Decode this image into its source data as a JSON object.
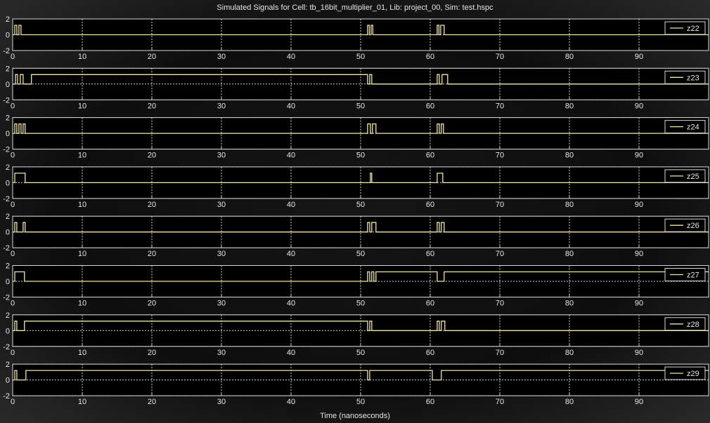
{
  "chart_data": {
    "type": "line",
    "title": "Simulated Signals for Cell: tb_16bit_multiplier_01, Lib: project_00, Sim: test.hspc",
    "xlabel": "Time (nanoseconds)",
    "xlim": [
      0,
      100
    ],
    "ylim": [
      -2,
      2
    ],
    "xticks": [
      0,
      10,
      20,
      30,
      40,
      50,
      60,
      70,
      80,
      90
    ],
    "yticks": [
      -2,
      0,
      2
    ],
    "grid": true,
    "legend_position": "top-right",
    "colors": {
      "background": "#000000",
      "trace": "#f0e6a0",
      "grid": "#d8d8d8",
      "text": "#e6e6e6"
    },
    "series": [
      {
        "name": "z22",
        "t": [
          0,
          0.3,
          0.3,
          0.6,
          0.6,
          0.9,
          0.9,
          1.2,
          1.2,
          2.7,
          2.7,
          51.0,
          51.0,
          51.25,
          51.25,
          51.5,
          51.5,
          51.75,
          51.75,
          52.0,
          52.0,
          61.0,
          61.0,
          61.25,
          61.25,
          61.5,
          61.5,
          62.0,
          62.0,
          62.3,
          62.3,
          100
        ],
        "v": [
          0,
          0,
          1.2,
          1.2,
          0,
          0,
          1.2,
          1.2,
          0,
          0,
          0,
          0,
          1.2,
          1.2,
          0,
          0,
          1.2,
          1.2,
          0,
          0,
          0,
          0,
          1.2,
          1.2,
          0,
          0,
          1.2,
          1.2,
          0,
          0,
          0,
          0
        ]
      },
      {
        "name": "z23",
        "t": [
          0,
          0.4,
          0.4,
          0.7,
          0.7,
          1.1,
          1.1,
          1.5,
          1.5,
          2.7,
          2.7,
          51.0,
          51.0,
          51.3,
          51.3,
          51.6,
          51.6,
          51.9,
          51.9,
          61.0,
          61.0,
          61.3,
          61.3,
          61.7,
          61.7,
          62.5,
          62.5,
          100
        ],
        "v": [
          0,
          0,
          1.2,
          1.2,
          0,
          0,
          1.2,
          1.2,
          0,
          0,
          1.2,
          1.2,
          0,
          0,
          1.2,
          1.2,
          0,
          0,
          0,
          0,
          1.2,
          1.2,
          0,
          0,
          1.2,
          1.2,
          0,
          0
        ]
      },
      {
        "name": "z24",
        "t": [
          0,
          0.3,
          0.3,
          0.6,
          0.6,
          0.9,
          0.9,
          1.2,
          1.2,
          1.5,
          1.5,
          1.8,
          1.8,
          51.0,
          51.0,
          51.4,
          51.4,
          51.7,
          51.7,
          52.2,
          52.2,
          61.0,
          61.0,
          61.3,
          61.3,
          61.6,
          61.6,
          61.9,
          61.9,
          62.2,
          62.2,
          100
        ],
        "v": [
          0,
          0,
          1.2,
          1.2,
          0,
          0,
          1.2,
          1.2,
          0,
          0,
          1.2,
          1.2,
          0,
          0,
          1.2,
          1.2,
          0,
          0,
          1.2,
          1.2,
          0,
          0,
          1.2,
          1.2,
          0,
          0,
          1.2,
          1.2,
          0,
          0,
          0,
          0
        ]
      },
      {
        "name": "z25",
        "t": [
          0,
          0.3,
          0.3,
          1.8,
          1.8,
          51.4,
          51.4,
          51.6,
          51.6,
          61.0,
          61.0,
          61.8,
          61.8,
          100
        ],
        "v": [
          0,
          0,
          1.2,
          1.2,
          0,
          0,
          1.2,
          1.2,
          0,
          0,
          1.2,
          1.2,
          0,
          0
        ]
      },
      {
        "name": "z26",
        "t": [
          0,
          0.3,
          0.3,
          0.6,
          0.6,
          1.5,
          1.5,
          1.8,
          1.8,
          51.0,
          51.0,
          51.3,
          51.3,
          51.6,
          51.6,
          52.2,
          52.2,
          61.0,
          61.0,
          61.3,
          61.3,
          61.6,
          61.6,
          62.0,
          62.0,
          100
        ],
        "v": [
          0,
          0,
          1.2,
          1.2,
          0,
          0,
          1.2,
          1.2,
          0,
          0,
          1.2,
          1.2,
          0,
          0,
          1.2,
          1.2,
          0,
          0,
          1.2,
          1.2,
          0,
          0,
          1.2,
          1.2,
          0,
          0
        ]
      },
      {
        "name": "z27",
        "t": [
          0,
          0.3,
          0.3,
          1.7,
          1.7,
          51.0,
          51.0,
          51.3,
          51.3,
          51.6,
          51.6,
          51.9,
          51.9,
          52.2,
          52.2,
          61.0,
          61.0,
          62.0,
          62.0,
          100
        ],
        "v": [
          0,
          0,
          1.2,
          1.2,
          0,
          0,
          1.2,
          1.2,
          0,
          0,
          1.2,
          1.2,
          0,
          0,
          1.2,
          1.2,
          0,
          0,
          1.2,
          1.2
        ]
      },
      {
        "name": "z28",
        "t": [
          0,
          0.3,
          0.3,
          0.6,
          0.6,
          1.7,
          1.7,
          51.0,
          51.0,
          51.3,
          51.3,
          51.6,
          51.6,
          61.0,
          61.0,
          61.3,
          61.3,
          61.6,
          61.6,
          62.1,
          62.1,
          100
        ],
        "v": [
          0,
          0,
          1.2,
          1.2,
          0,
          0,
          1.2,
          1.2,
          0,
          0,
          1.2,
          1.2,
          0,
          0,
          1.2,
          1.2,
          0,
          0,
          1.2,
          1.2,
          0,
          0
        ]
      },
      {
        "name": "z29",
        "t": [
          0,
          0.3,
          0.3,
          0.6,
          0.6,
          1.9,
          1.9,
          51.0,
          51.0,
          51.3,
          51.3,
          60.3,
          60.3,
          60.6,
          60.6,
          61.6,
          61.6,
          100
        ],
        "v": [
          0,
          0,
          1.2,
          1.2,
          0,
          0,
          1.2,
          1.2,
          0,
          0,
          1.2,
          1.2,
          0,
          0,
          0,
          0,
          1.2,
          1.2
        ]
      }
    ]
  }
}
